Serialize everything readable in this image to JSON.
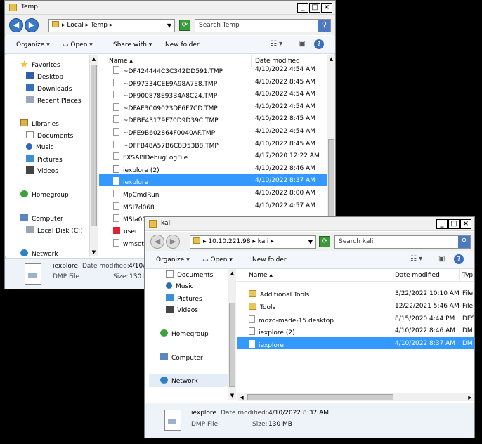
{
  "temp_window": {
    "title": "Temp",
    "breadcrumb": [
      "Local",
      "Temp"
    ],
    "search_placeholder": "Search Temp",
    "toolbar": {
      "organize": "Organize",
      "open": "Open",
      "share_with": "Share with",
      "new_folder": "New folder"
    },
    "nav": {
      "favorites": "Favorites",
      "desktop": "Desktop",
      "downloads": "Downloads",
      "recent_places": "Recent Places",
      "libraries": "Libraries",
      "documents": "Documents",
      "music": "Music",
      "pictures": "Pictures",
      "videos": "Videos",
      "homegroup": "Homegroup",
      "computer": "Computer",
      "local_disk": "Local Disk (C:)",
      "network": "Network"
    },
    "columns": {
      "name": "Name",
      "date_modified": "Date modified"
    },
    "files": [
      {
        "name": "~DF424444C3C342DD591.TMP",
        "date": "4/10/2022 4:54 AM",
        "icon": "file-icon"
      },
      {
        "name": "~DF97334CEE9A98A7E8.TMP",
        "date": "4/10/2022 8:45 AM",
        "icon": "file-icon"
      },
      {
        "name": "~DF900878E93B4A8C24.TMP",
        "date": "4/10/2022 4:54 AM",
        "icon": "file-icon"
      },
      {
        "name": "~DFAE3C09023DF6F7CD.TMP",
        "date": "4/10/2022 4:54 AM",
        "icon": "file-icon"
      },
      {
        "name": "~DFBE43179F70D9D39C.TMP",
        "date": "4/10/2022 8:45 AM",
        "icon": "file-icon"
      },
      {
        "name": "~DFE9B602864F0040AF.TMP",
        "date": "4/10/2022 4:54 AM",
        "icon": "file-icon"
      },
      {
        "name": "~DFFB48A57B6C8D53B8.TMP",
        "date": "4/10/2022 8:45 AM",
        "icon": "file-icon"
      },
      {
        "name": "FXSAPIDebugLogFile",
        "date": "4/17/2020 12:22 AM",
        "icon": "file-icon"
      },
      {
        "name": "iexplore (2)",
        "date": "4/10/2022 8:46 AM",
        "icon": "dmp-file-icon"
      },
      {
        "name": "iexplore",
        "date": "4/10/2022 8:37 AM",
        "icon": "dmp-file-icon",
        "selected": true
      },
      {
        "name": "MpCmdRun",
        "date": "4/10/2022 8:00 AM",
        "icon": "file-icon"
      },
      {
        "name": "MSI7d068",
        "date": "4/10/2022 4:57 AM",
        "icon": "file-icon"
      },
      {
        "name": "MSIa004",
        "date": "",
        "icon": "file-icon"
      },
      {
        "name": "user",
        "date": "",
        "icon": "user-icon"
      },
      {
        "name": "wmsetu",
        "date": "",
        "icon": "file-icon"
      }
    ],
    "details": {
      "name": "iexplore",
      "date_label": "Date modified:",
      "date_value": "4/10/",
      "type": "DMP File",
      "size_label": "Size:",
      "size_value": "130 M"
    }
  },
  "kali_window": {
    "title": "kali",
    "breadcrumb": [
      "10.10.221.98",
      "kali"
    ],
    "search_placeholder": "Search kali",
    "toolbar": {
      "organize": "Organize",
      "open": "Open",
      "new_folder": "New folder"
    },
    "nav": {
      "documents": "Documents",
      "music": "Music",
      "pictures": "Pictures",
      "videos": "Videos",
      "homegroup": "Homegroup",
      "computer": "Computer",
      "network": "Network"
    },
    "columns": {
      "name": "Name",
      "date_modified": "Date modified",
      "type": "Typ"
    },
    "files": [
      {
        "name": "Additional Tools",
        "date": "3/22/2022 10:10 AM",
        "type": "File",
        "icon": "folder-icon"
      },
      {
        "name": "Tools",
        "date": "12/22/2021 5:46 AM",
        "type": "File",
        "icon": "folder-icon"
      },
      {
        "name": "mozo-made-15.desktop",
        "date": "8/15/2020 4:44 PM",
        "type": "DES",
        "icon": "file-icon"
      },
      {
        "name": "iexplore (2)",
        "date": "4/10/2022 8:46 AM",
        "type": "DM",
        "icon": "dmp-file-icon"
      },
      {
        "name": "iexplore",
        "date": "4/10/2022 8:37 AM",
        "type": "DM",
        "icon": "dmp-file-icon",
        "selected": true
      }
    ],
    "details": {
      "name": "iexplore",
      "date_label": "Date modified:",
      "date_value": "4/10/2022 8:37 AM",
      "type": "DMP File",
      "size_label": "Size:",
      "size_value": "130 MB"
    }
  },
  "colors": {
    "selection": "#3399ff",
    "details_bg": "#eef3fa",
    "toolbar_bg": "#f3f6fa"
  }
}
